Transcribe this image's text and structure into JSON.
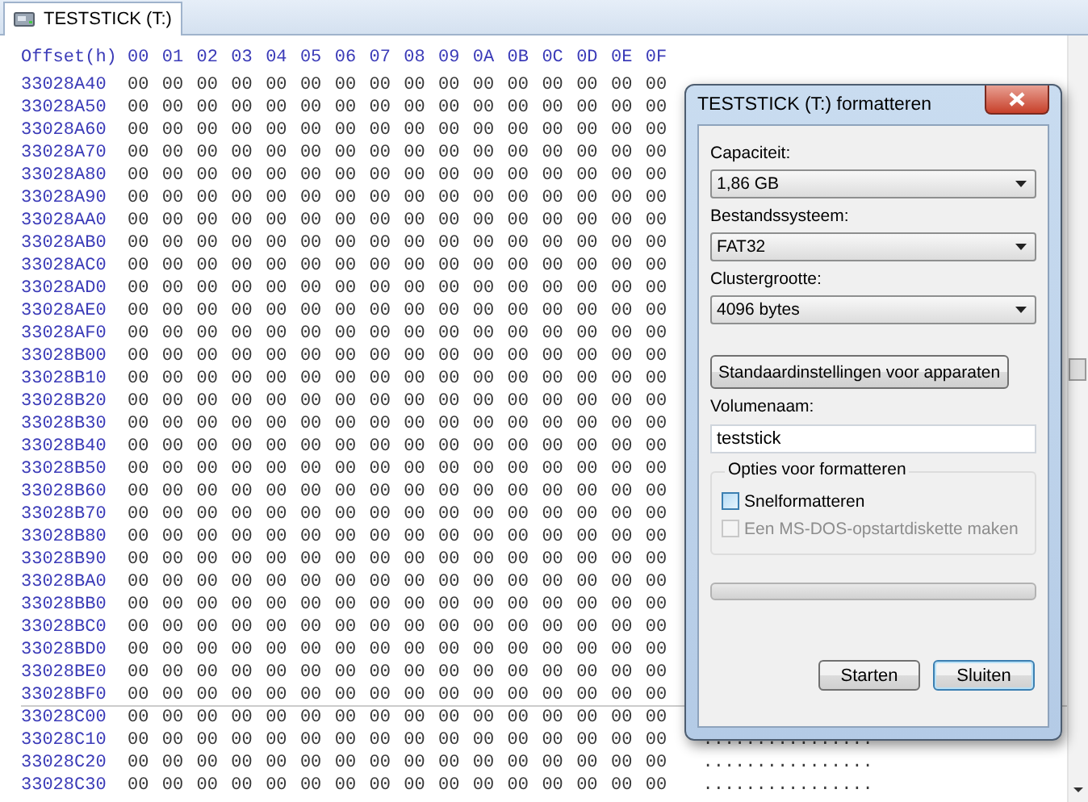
{
  "tab": {
    "label": "TESTSTICK (T:)",
    "selected": true
  },
  "hex": {
    "offset_header": "Offset(h)",
    "column_headers": [
      "00",
      "01",
      "02",
      "03",
      "04",
      "05",
      "06",
      "07",
      "08",
      "09",
      "0A",
      "0B",
      "0C",
      "0D",
      "0E",
      "0F"
    ],
    "rows": [
      {
        "offset": "33028A40",
        "sector_start": false,
        "bytes": [
          "00",
          "00",
          "00",
          "00",
          "00",
          "00",
          "00",
          "00",
          "00",
          "00",
          "00",
          "00",
          "00",
          "00",
          "00",
          "00"
        ]
      },
      {
        "offset": "33028A50",
        "sector_start": false,
        "bytes": [
          "00",
          "00",
          "00",
          "00",
          "00",
          "00",
          "00",
          "00",
          "00",
          "00",
          "00",
          "00",
          "00",
          "00",
          "00",
          "00"
        ]
      },
      {
        "offset": "33028A60",
        "sector_start": false,
        "bytes": [
          "00",
          "00",
          "00",
          "00",
          "00",
          "00",
          "00",
          "00",
          "00",
          "00",
          "00",
          "00",
          "00",
          "00",
          "00",
          "00"
        ]
      },
      {
        "offset": "33028A70",
        "sector_start": false,
        "bytes": [
          "00",
          "00",
          "00",
          "00",
          "00",
          "00",
          "00",
          "00",
          "00",
          "00",
          "00",
          "00",
          "00",
          "00",
          "00",
          "00"
        ]
      },
      {
        "offset": "33028A80",
        "sector_start": false,
        "bytes": [
          "00",
          "00",
          "00",
          "00",
          "00",
          "00",
          "00",
          "00",
          "00",
          "00",
          "00",
          "00",
          "00",
          "00",
          "00",
          "00"
        ]
      },
      {
        "offset": "33028A90",
        "sector_start": false,
        "bytes": [
          "00",
          "00",
          "00",
          "00",
          "00",
          "00",
          "00",
          "00",
          "00",
          "00",
          "00",
          "00",
          "00",
          "00",
          "00",
          "00"
        ]
      },
      {
        "offset": "33028AA0",
        "sector_start": false,
        "bytes": [
          "00",
          "00",
          "00",
          "00",
          "00",
          "00",
          "00",
          "00",
          "00",
          "00",
          "00",
          "00",
          "00",
          "00",
          "00",
          "00"
        ]
      },
      {
        "offset": "33028AB0",
        "sector_start": false,
        "bytes": [
          "00",
          "00",
          "00",
          "00",
          "00",
          "00",
          "00",
          "00",
          "00",
          "00",
          "00",
          "00",
          "00",
          "00",
          "00",
          "00"
        ]
      },
      {
        "offset": "33028AC0",
        "sector_start": false,
        "bytes": [
          "00",
          "00",
          "00",
          "00",
          "00",
          "00",
          "00",
          "00",
          "00",
          "00",
          "00",
          "00",
          "00",
          "00",
          "00",
          "00"
        ]
      },
      {
        "offset": "33028AD0",
        "sector_start": false,
        "bytes": [
          "00",
          "00",
          "00",
          "00",
          "00",
          "00",
          "00",
          "00",
          "00",
          "00",
          "00",
          "00",
          "00",
          "00",
          "00",
          "00"
        ]
      },
      {
        "offset": "33028AE0",
        "sector_start": false,
        "bytes": [
          "00",
          "00",
          "00",
          "00",
          "00",
          "00",
          "00",
          "00",
          "00",
          "00",
          "00",
          "00",
          "00",
          "00",
          "00",
          "00"
        ]
      },
      {
        "offset": "33028AF0",
        "sector_start": false,
        "bytes": [
          "00",
          "00",
          "00",
          "00",
          "00",
          "00",
          "00",
          "00",
          "00",
          "00",
          "00",
          "00",
          "00",
          "00",
          "00",
          "00"
        ]
      },
      {
        "offset": "33028B00",
        "sector_start": false,
        "bytes": [
          "00",
          "00",
          "00",
          "00",
          "00",
          "00",
          "00",
          "00",
          "00",
          "00",
          "00",
          "00",
          "00",
          "00",
          "00",
          "00"
        ]
      },
      {
        "offset": "33028B10",
        "sector_start": false,
        "bytes": [
          "00",
          "00",
          "00",
          "00",
          "00",
          "00",
          "00",
          "00",
          "00",
          "00",
          "00",
          "00",
          "00",
          "00",
          "00",
          "00"
        ]
      },
      {
        "offset": "33028B20",
        "sector_start": false,
        "bytes": [
          "00",
          "00",
          "00",
          "00",
          "00",
          "00",
          "00",
          "00",
          "00",
          "00",
          "00",
          "00",
          "00",
          "00",
          "00",
          "00"
        ]
      },
      {
        "offset": "33028B30",
        "sector_start": false,
        "bytes": [
          "00",
          "00",
          "00",
          "00",
          "00",
          "00",
          "00",
          "00",
          "00",
          "00",
          "00",
          "00",
          "00",
          "00",
          "00",
          "00"
        ]
      },
      {
        "offset": "33028B40",
        "sector_start": false,
        "bytes": [
          "00",
          "00",
          "00",
          "00",
          "00",
          "00",
          "00",
          "00",
          "00",
          "00",
          "00",
          "00",
          "00",
          "00",
          "00",
          "00"
        ]
      },
      {
        "offset": "33028B50",
        "sector_start": false,
        "bytes": [
          "00",
          "00",
          "00",
          "00",
          "00",
          "00",
          "00",
          "00",
          "00",
          "00",
          "00",
          "00",
          "00",
          "00",
          "00",
          "00"
        ]
      },
      {
        "offset": "33028B60",
        "sector_start": false,
        "bytes": [
          "00",
          "00",
          "00",
          "00",
          "00",
          "00",
          "00",
          "00",
          "00",
          "00",
          "00",
          "00",
          "00",
          "00",
          "00",
          "00"
        ]
      },
      {
        "offset": "33028B70",
        "sector_start": false,
        "bytes": [
          "00",
          "00",
          "00",
          "00",
          "00",
          "00",
          "00",
          "00",
          "00",
          "00",
          "00",
          "00",
          "00",
          "00",
          "00",
          "00"
        ]
      },
      {
        "offset": "33028B80",
        "sector_start": false,
        "bytes": [
          "00",
          "00",
          "00",
          "00",
          "00",
          "00",
          "00",
          "00",
          "00",
          "00",
          "00",
          "00",
          "00",
          "00",
          "00",
          "00"
        ]
      },
      {
        "offset": "33028B90",
        "sector_start": false,
        "bytes": [
          "00",
          "00",
          "00",
          "00",
          "00",
          "00",
          "00",
          "00",
          "00",
          "00",
          "00",
          "00",
          "00",
          "00",
          "00",
          "00"
        ]
      },
      {
        "offset": "33028BA0",
        "sector_start": false,
        "bytes": [
          "00",
          "00",
          "00",
          "00",
          "00",
          "00",
          "00",
          "00",
          "00",
          "00",
          "00",
          "00",
          "00",
          "00",
          "00",
          "00"
        ]
      },
      {
        "offset": "33028BB0",
        "sector_start": false,
        "bytes": [
          "00",
          "00",
          "00",
          "00",
          "00",
          "00",
          "00",
          "00",
          "00",
          "00",
          "00",
          "00",
          "00",
          "00",
          "00",
          "00"
        ]
      },
      {
        "offset": "33028BC0",
        "sector_start": false,
        "bytes": [
          "00",
          "00",
          "00",
          "00",
          "00",
          "00",
          "00",
          "00",
          "00",
          "00",
          "00",
          "00",
          "00",
          "00",
          "00",
          "00"
        ]
      },
      {
        "offset": "33028BD0",
        "sector_start": false,
        "bytes": [
          "00",
          "00",
          "00",
          "00",
          "00",
          "00",
          "00",
          "00",
          "00",
          "00",
          "00",
          "00",
          "00",
          "00",
          "00",
          "00"
        ]
      },
      {
        "offset": "33028BE0",
        "sector_start": false,
        "bytes": [
          "00",
          "00",
          "00",
          "00",
          "00",
          "00",
          "00",
          "00",
          "00",
          "00",
          "00",
          "00",
          "00",
          "00",
          "00",
          "00"
        ]
      },
      {
        "offset": "33028BF0",
        "sector_start": false,
        "bytes": [
          "00",
          "00",
          "00",
          "00",
          "00",
          "00",
          "00",
          "00",
          "00",
          "00",
          "00",
          "00",
          "00",
          "00",
          "00",
          "00"
        ]
      },
      {
        "offset": "33028C00",
        "sector_start": true,
        "bytes": [
          "00",
          "00",
          "00",
          "00",
          "00",
          "00",
          "00",
          "00",
          "00",
          "00",
          "00",
          "00",
          "00",
          "00",
          "00",
          "00"
        ]
      },
      {
        "offset": "33028C10",
        "sector_start": false,
        "bytes": [
          "00",
          "00",
          "00",
          "00",
          "00",
          "00",
          "00",
          "00",
          "00",
          "00",
          "00",
          "00",
          "00",
          "00",
          "00",
          "00"
        ],
        "ascii": "................"
      },
      {
        "offset": "33028C20",
        "sector_start": false,
        "bytes": [
          "00",
          "00",
          "00",
          "00",
          "00",
          "00",
          "00",
          "00",
          "00",
          "00",
          "00",
          "00",
          "00",
          "00",
          "00",
          "00"
        ],
        "ascii": "................"
      },
      {
        "offset": "33028C30",
        "sector_start": false,
        "bytes": [
          "00",
          "00",
          "00",
          "00",
          "00",
          "00",
          "00",
          "00",
          "00",
          "00",
          "00",
          "00",
          "00",
          "00",
          "00",
          "00"
        ],
        "ascii": "................"
      }
    ]
  },
  "dialog": {
    "title": "TESTSTICK (T:) formatteren",
    "selects": [
      {
        "label": "Capaciteit:",
        "value": "1,86 GB"
      },
      {
        "label": "Bestandssysteem:",
        "value": "FAT32"
      },
      {
        "label": "Clustergrootte:",
        "value": "4096 bytes"
      }
    ],
    "defaults_button": "Standaardinstellingen voor apparaten",
    "volume": {
      "label": "Volumenaam:",
      "value": "teststick"
    },
    "options": {
      "legend": "Opties voor formatteren",
      "checkboxes": [
        {
          "label": "Snelformatteren",
          "checked": false,
          "disabled": false,
          "hovered": true
        },
        {
          "label": "Een MS-DOS-opstartdiskette maken",
          "checked": false,
          "disabled": true,
          "hovered": false
        }
      ]
    },
    "progress": {
      "level": 0
    },
    "buttons": [
      {
        "label": "Starten",
        "default": false
      },
      {
        "label": "Sluiten",
        "default": true
      }
    ]
  }
}
